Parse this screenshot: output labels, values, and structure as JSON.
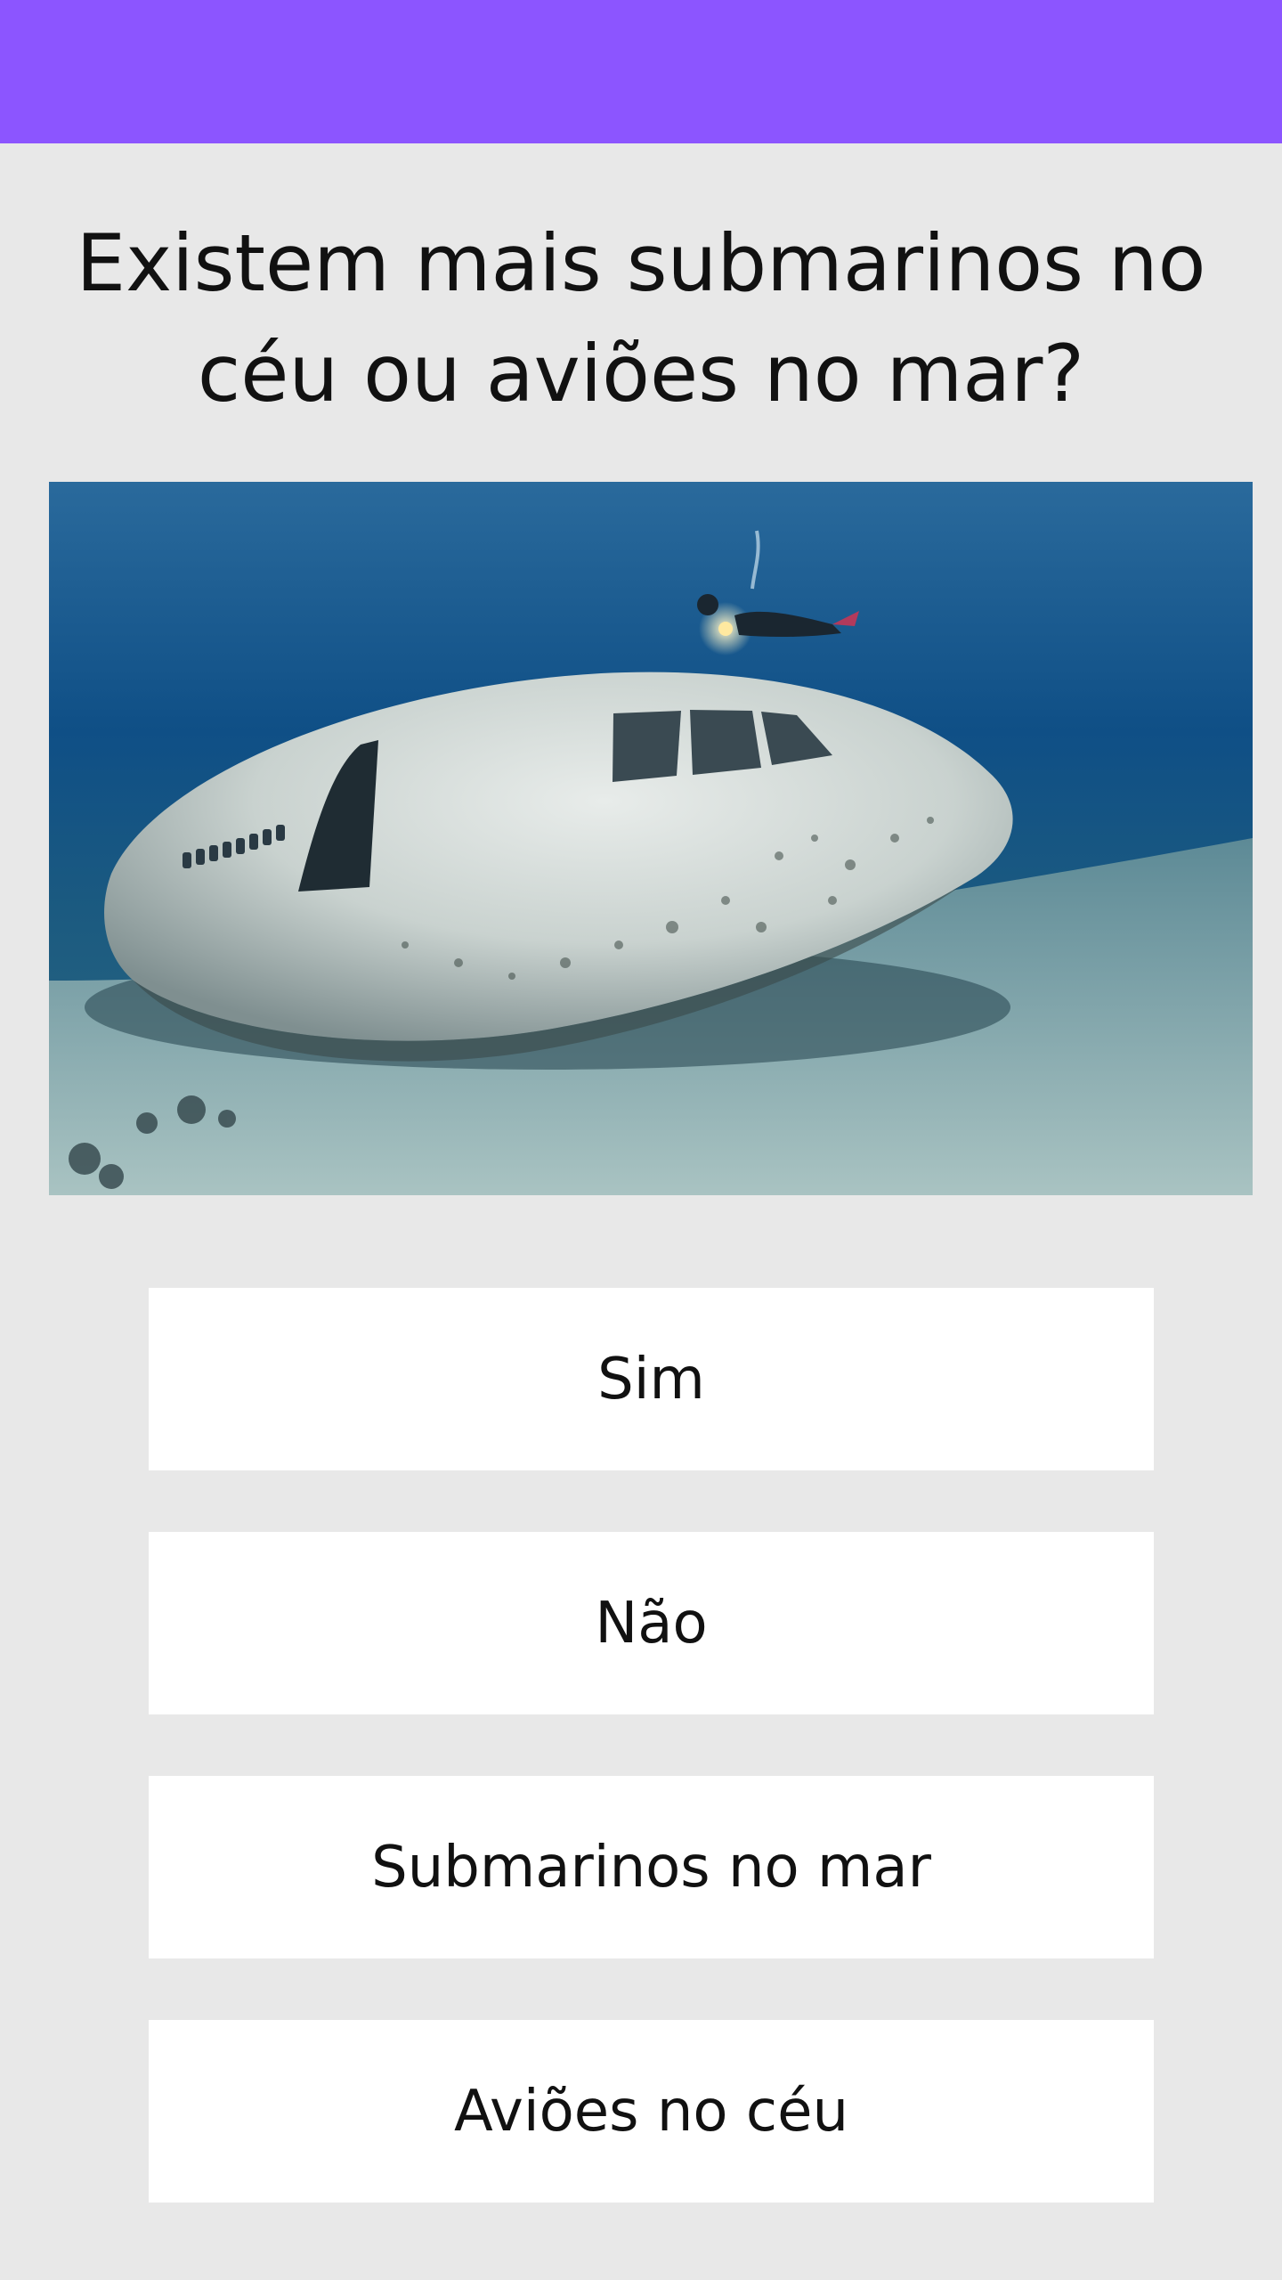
{
  "header": {
    "color": "#8c55ff"
  },
  "quiz": {
    "question": "Existem mais submarinos no céu ou aviões no mar?",
    "image": {
      "icon": "sunken-airplane-photo"
    },
    "answers": [
      {
        "label": "Sim"
      },
      {
        "label": "Não"
      },
      {
        "label": "Submarinos no mar"
      },
      {
        "label": "Aviões no céu"
      }
    ]
  }
}
